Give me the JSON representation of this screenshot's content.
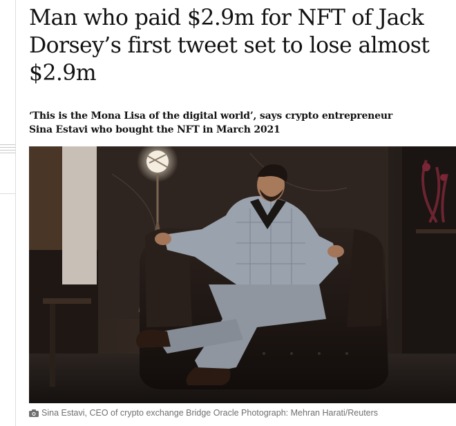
{
  "article": {
    "headline": "Man who paid $2.9m for NFT of Jack Dorsey’s first tweet set to lose almost $2.9m",
    "standfirst": "‘This is the Mona Lisa of the digital world’, says crypto entrepreneur Sina Estavi who bought the NFT in March 2021",
    "caption": "Sina Estavi, CEO of crypto exchange Bridge Oracle Photograph: Mehran Harati/Reuters"
  },
  "icons": {
    "caption_icon": "camera-icon"
  },
  "colors": {
    "text": "#121212",
    "caption": "#707070",
    "rule": "#dcdcdc"
  }
}
